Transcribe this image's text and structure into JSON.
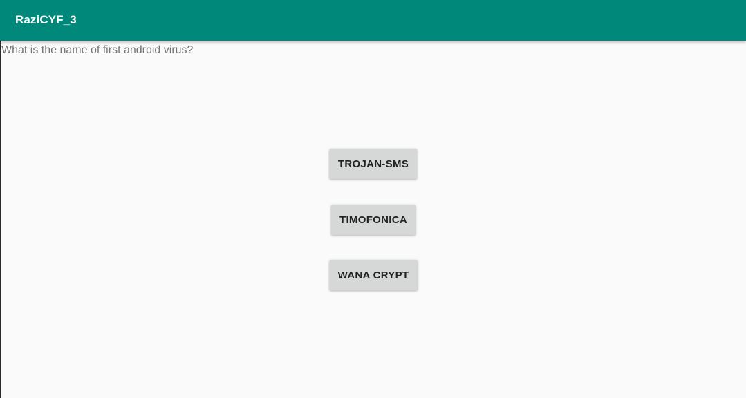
{
  "app_bar": {
    "title": "RaziCYF_3",
    "color": "#00897b"
  },
  "question": {
    "text": "What is the name of first android virus?"
  },
  "answers": [
    {
      "label": "TROJAN-SMS"
    },
    {
      "label": "TIMOFONICA"
    },
    {
      "label": "WANA CRYPT"
    }
  ],
  "colors": {
    "background": "#fafafa",
    "button": "#d6d7d7",
    "question_text": "#737373"
  }
}
